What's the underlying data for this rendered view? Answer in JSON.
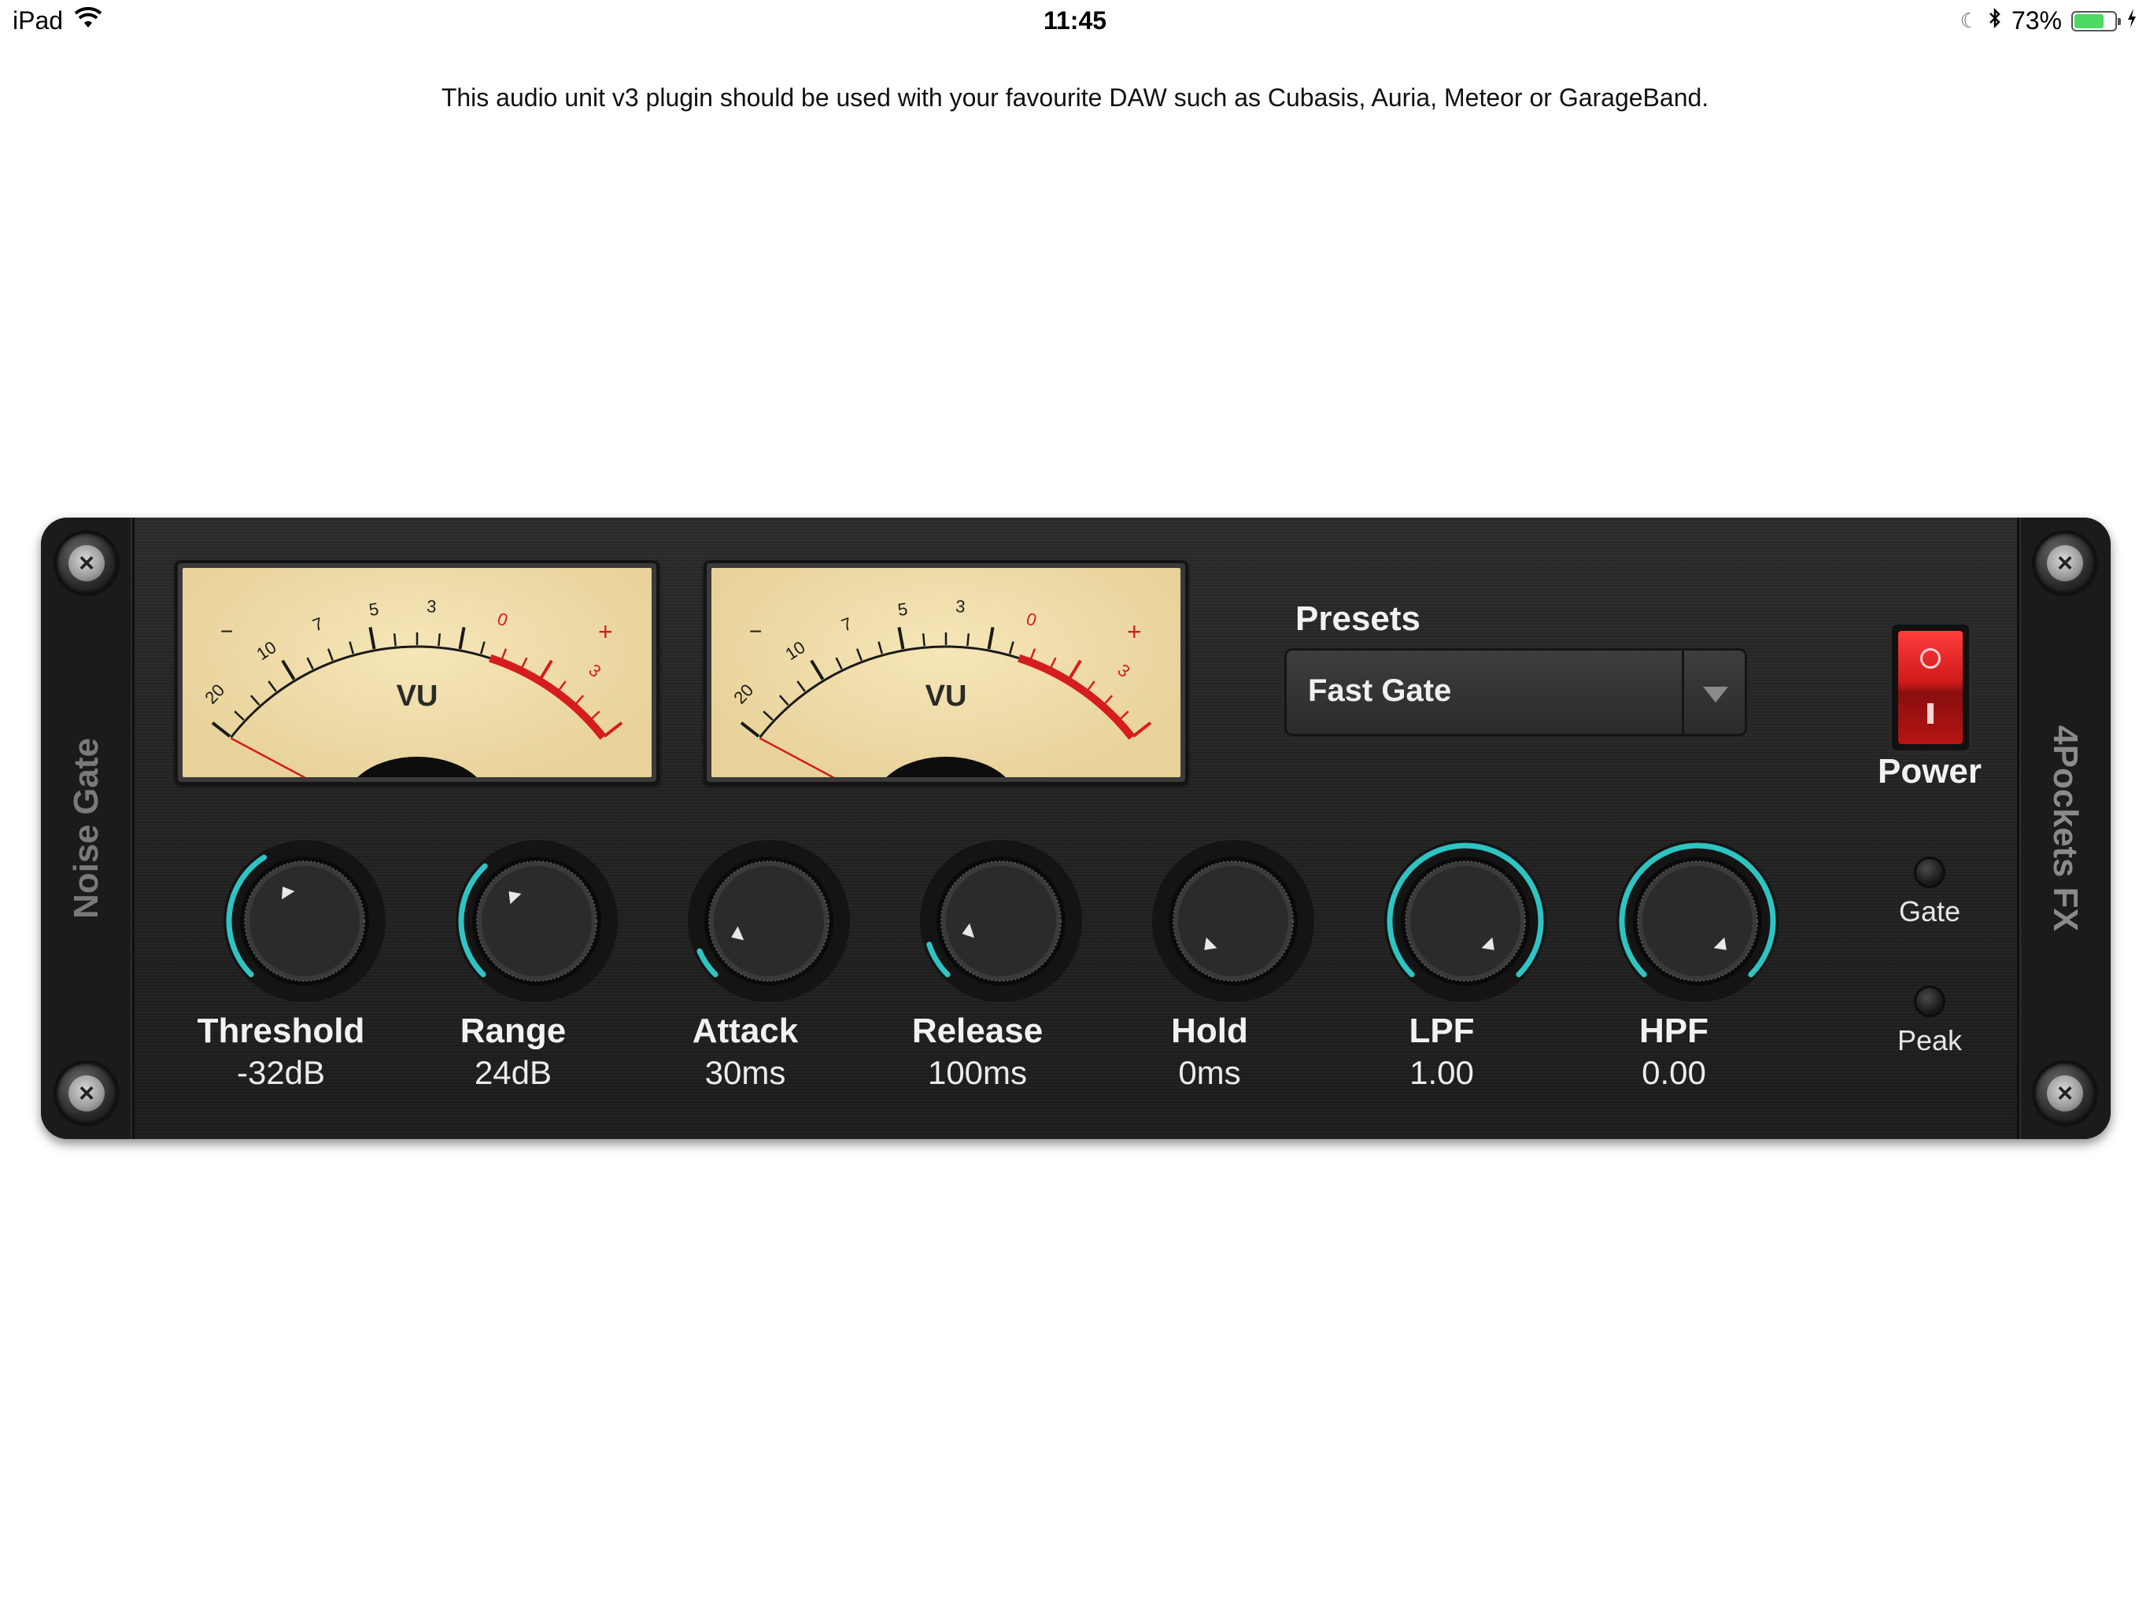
{
  "status_bar": {
    "device": "iPad",
    "time": "11:45",
    "battery_percent": "73%",
    "battery_level": 0.73
  },
  "info_text": "This audio unit v3 plugin should be used with your favourite DAW such as Cubasis, Auria, Meteor or GarageBand.",
  "plugin": {
    "name": "Noise Gate",
    "brand": "4Pockets FX",
    "vu_meters": [
      {
        "label": "VU",
        "scale": [
          "20",
          "10",
          "7",
          "5",
          "3",
          "0",
          "3"
        ],
        "minus": "−",
        "plus": "+"
      },
      {
        "label": "VU",
        "scale": [
          "20",
          "10",
          "7",
          "5",
          "3",
          "0",
          "3"
        ],
        "minus": "−",
        "plus": "+"
      }
    ],
    "presets": {
      "title": "Presets",
      "selected": "Fast Gate"
    },
    "power": {
      "label": "Power",
      "on": true
    },
    "leds": [
      {
        "label": "Gate",
        "lit": false
      },
      {
        "label": "Peak",
        "lit": false
      }
    ],
    "knobs": [
      {
        "name": "Threshold",
        "value": "-32dB",
        "level": 0.38
      },
      {
        "name": "Range",
        "value": "24dB",
        "level": 0.34
      },
      {
        "name": "Attack",
        "value": "30ms",
        "level": 0.08
      },
      {
        "name": "Release",
        "value": "100ms",
        "level": 0.1
      },
      {
        "name": "Hold",
        "value": "0ms",
        "level": 0.0
      },
      {
        "name": "LPF",
        "value": "1.00",
        "level": 1.0
      },
      {
        "name": "HPF",
        "value": "0.00",
        "level": 1.0
      }
    ],
    "accent_color": "#2ec4c4"
  }
}
